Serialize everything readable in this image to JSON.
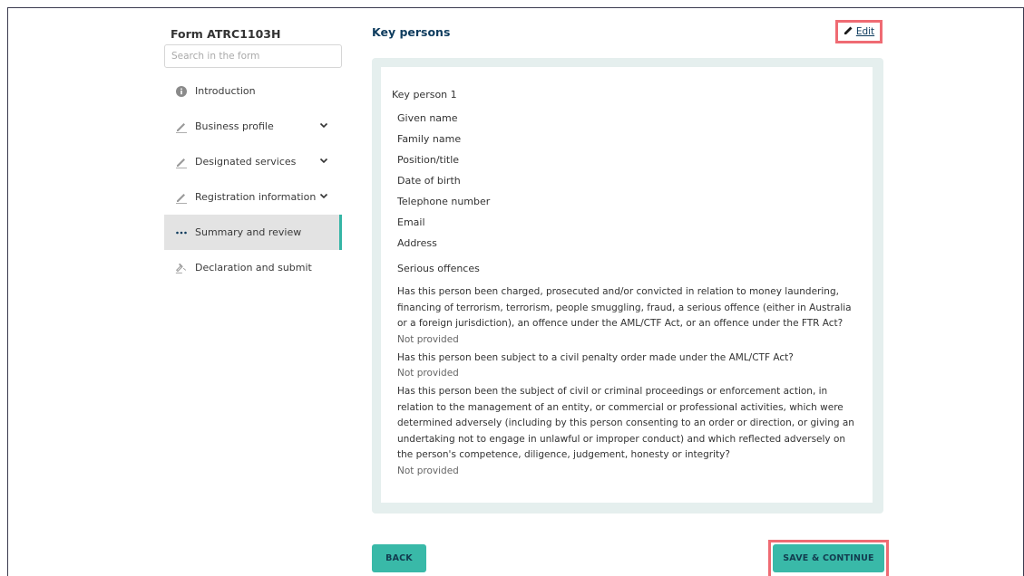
{
  "sidebar": {
    "form_title": "Form ATRC1103H",
    "search_placeholder": "Search in the form",
    "items": [
      {
        "label": "Introduction"
      },
      {
        "label": "Business profile"
      },
      {
        "label": "Designated services"
      },
      {
        "label": "Registration information"
      },
      {
        "label": "Summary and review"
      },
      {
        "label": "Declaration and submit"
      }
    ]
  },
  "main": {
    "section_title": "Key persons",
    "edit_label": "Edit",
    "key_person_title": "Key person 1",
    "fields": [
      "Given name",
      "Family name",
      "Position/title",
      "Date of birth",
      "Telephone number",
      "Email",
      "Address"
    ],
    "serious_offences_title": "Serious offences",
    "questions": [
      {
        "q": "Has this person been charged, prosecuted and/or convicted in relation to money laundering, financing of terrorism, terrorism, people smuggling, fraud, a serious offence (either in Australia or a foreign jurisdiction), an offence under the AML/CTF Act, or an offence under the FTR Act?",
        "a": "Not provided"
      },
      {
        "q": "Has this person been subject to a civil penalty order made under the AML/CTF Act?",
        "a": "Not provided"
      },
      {
        "q": "Has this person been the subject of civil or criminal proceedings or enforcement action, in relation to the management of an entity, or commercial or professional activities, which were determined adversely (including by this person consenting to an order or direction, or giving an undertaking not to engage in unlawful or improper conduct) and which reflected adversely on the person's competence, diligence, judgement, honesty or integrity?",
        "a": "Not provided"
      }
    ]
  },
  "footer": {
    "back_label": "BACK",
    "continue_label": "SAVE & CONTINUE"
  },
  "colors": {
    "accent": "#39b9a8",
    "heading": "#0e3c5e",
    "highlight": "#ef6b73"
  }
}
